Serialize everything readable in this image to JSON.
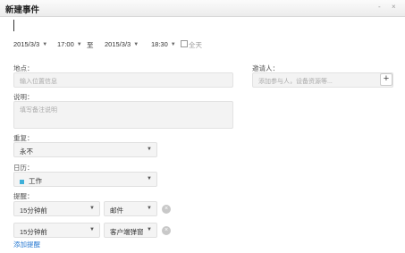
{
  "window": {
    "title": "新建事件",
    "minimize_glyph": "-",
    "close_glyph": "×"
  },
  "time": {
    "start_date": "2015/3/3",
    "start_time": "17:00",
    "separator": "至",
    "end_date": "2015/3/3",
    "end_time": "18:30",
    "all_day_label": "全天",
    "all_day_checked": false
  },
  "location": {
    "label": "地点：",
    "placeholder": "输入位置信息"
  },
  "invitees": {
    "label": "邀请人：",
    "placeholder": "添加参与人，设备资源等..."
  },
  "description": {
    "label": "说明：",
    "placeholder": "填写备注说明"
  },
  "repeat": {
    "label": "重复：",
    "value": "永不"
  },
  "calendar": {
    "label": "日历：",
    "value": "工作",
    "color": "#3fb0d9"
  },
  "reminders": {
    "label": "提醒：",
    "items": [
      {
        "time": "15分钟前",
        "method": "邮件"
      },
      {
        "time": "15分钟前",
        "method": "客户端弹窗"
      }
    ],
    "add_label": "添加提醒"
  }
}
